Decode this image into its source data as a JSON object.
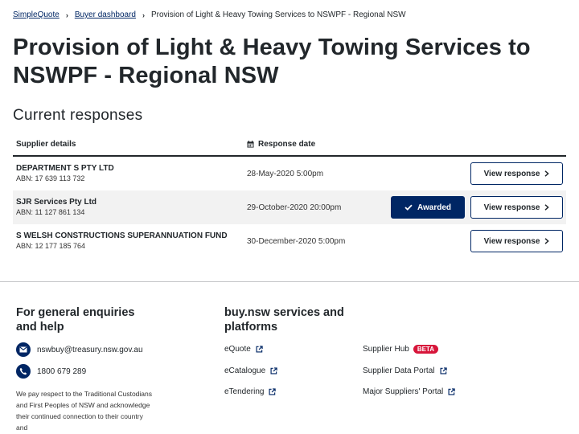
{
  "breadcrumb": {
    "home": "SimpleQuote",
    "dashboard": "Buyer dashboard",
    "current": "Provision of Light & Heavy Towing Services to NSWPF - Regional NSW"
  },
  "page_title": "Provision of Light & Heavy Towing Services to NSWPF - Regional NSW",
  "responses": {
    "title": "Current responses",
    "columns": {
      "supplier": "Supplier details",
      "date": "Response date"
    },
    "rows": [
      {
        "name": "DEPARTMENT S PTY LTD",
        "abn": "ABN: 17 639 113 732",
        "date": "28-May-2020 5:00pm",
        "awarded": false,
        "view_label": "View response"
      },
      {
        "name": "SJR Services Pty Ltd",
        "abn": "ABN: 11 127 861 134",
        "date": "29-October-2020 20:00pm",
        "awarded": true,
        "awarded_label": "Awarded",
        "view_label": "View response"
      },
      {
        "name": "S WELSH CONSTRUCTIONS SUPERANNUATION FUND",
        "abn": "ABN: 12 177 185 764",
        "date": "30-December-2020 5:00pm",
        "awarded": false,
        "view_label": "View response"
      }
    ]
  },
  "footer": {
    "enquiries_title": "For general enquiries and help",
    "email": "nswbuy@treasury.nsw.gov.au",
    "phone": "1800 679 289",
    "acknowledgement": "We pay respect to the Traditional Custodians and First Peoples of NSW and acknowledge their continued connection to their country and",
    "services_title": "buy.nsw services and platforms",
    "links_col1": [
      "eQuote",
      "eCatalogue",
      "eTendering"
    ],
    "links_col2": [
      "Supplier Hub",
      "Supplier Data Portal",
      "Major Suppliers' Portal"
    ],
    "beta_label": "BETA"
  },
  "colors": {
    "primary": "#002664",
    "beta": "#d7153a",
    "row_alt": "#f2f2f2"
  }
}
